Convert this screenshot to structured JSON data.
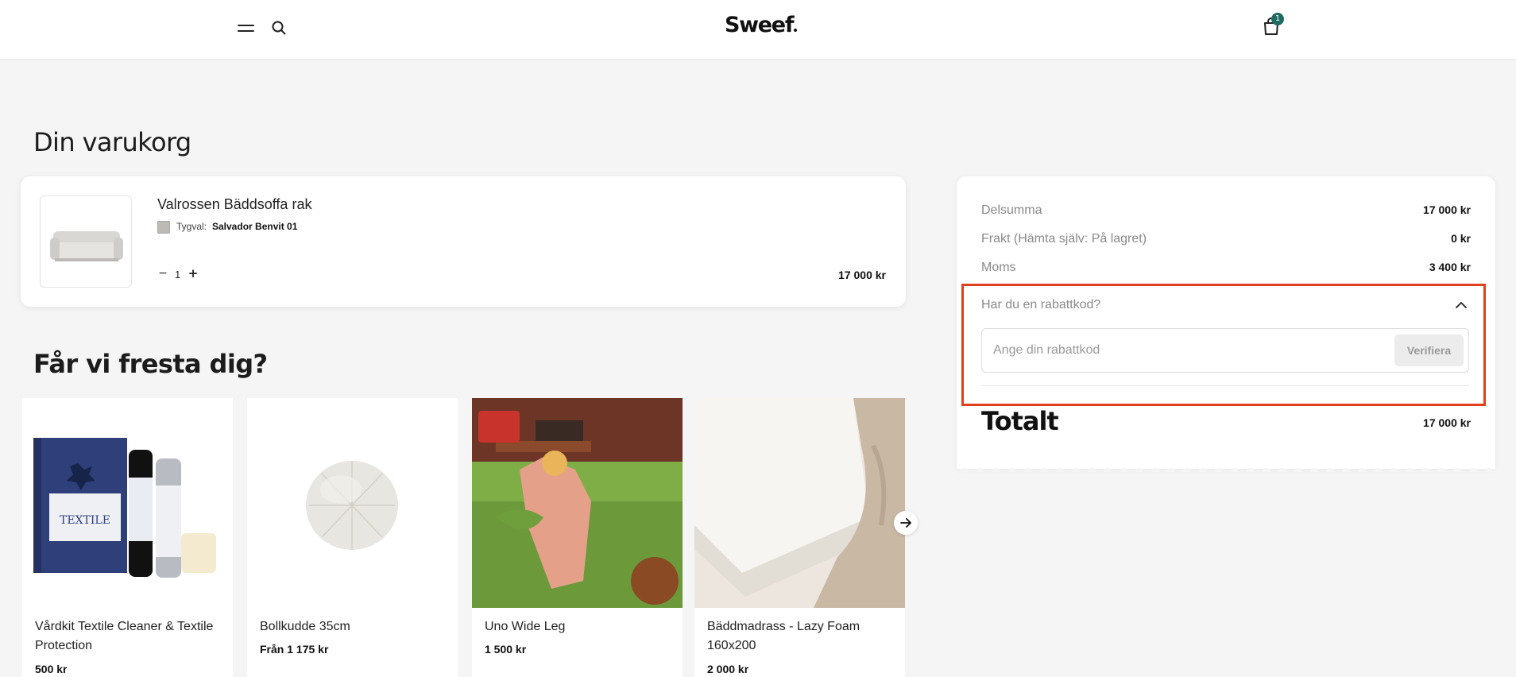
{
  "header": {
    "logo": "Sweef",
    "cart_count": "1"
  },
  "cart": {
    "title": "Din varukorg",
    "item": {
      "name": "Valrossen Bäddsoffa rak",
      "fabric_label": "Tygval:",
      "fabric_value": "Salvador Benvit 01",
      "quantity": "1",
      "price": "17 000 kr"
    }
  },
  "recommendations": {
    "title": "Får vi fresta dig?",
    "products": [
      {
        "name": "Vårdkit Textile Cleaner & Textile Protection",
        "price": "500 kr"
      },
      {
        "name": "Bollkudde 35cm",
        "price": "Från 1 175 kr"
      },
      {
        "name": "Uno Wide Leg",
        "price": "1 500 kr"
      },
      {
        "name": "Bäddmadrass - Lazy Foam 160x200",
        "price": "2 000 kr"
      }
    ]
  },
  "summary": {
    "subtotal_label": "Delsumma",
    "subtotal_value": "17 000 kr",
    "shipping_label": "Frakt (Hämta själv: På lagret)",
    "shipping_value": "0 kr",
    "vat_label": "Moms",
    "vat_value": "3 400 kr",
    "discount_question": "Har du en rabattkod?",
    "discount_placeholder": "Ange din rabattkod",
    "verify_label": "Verifiera",
    "total_label": "Totalt",
    "total_value": "17 000 kr"
  },
  "colors": {
    "accent_badge": "#1d6b63",
    "highlight_border": "#e1401f",
    "page_bg": "#f5f5f5"
  },
  "icons": [
    "menu-icon",
    "search-icon",
    "cart-icon",
    "minus-icon",
    "plus-icon",
    "chevron-up-icon",
    "arrow-right-icon"
  ]
}
